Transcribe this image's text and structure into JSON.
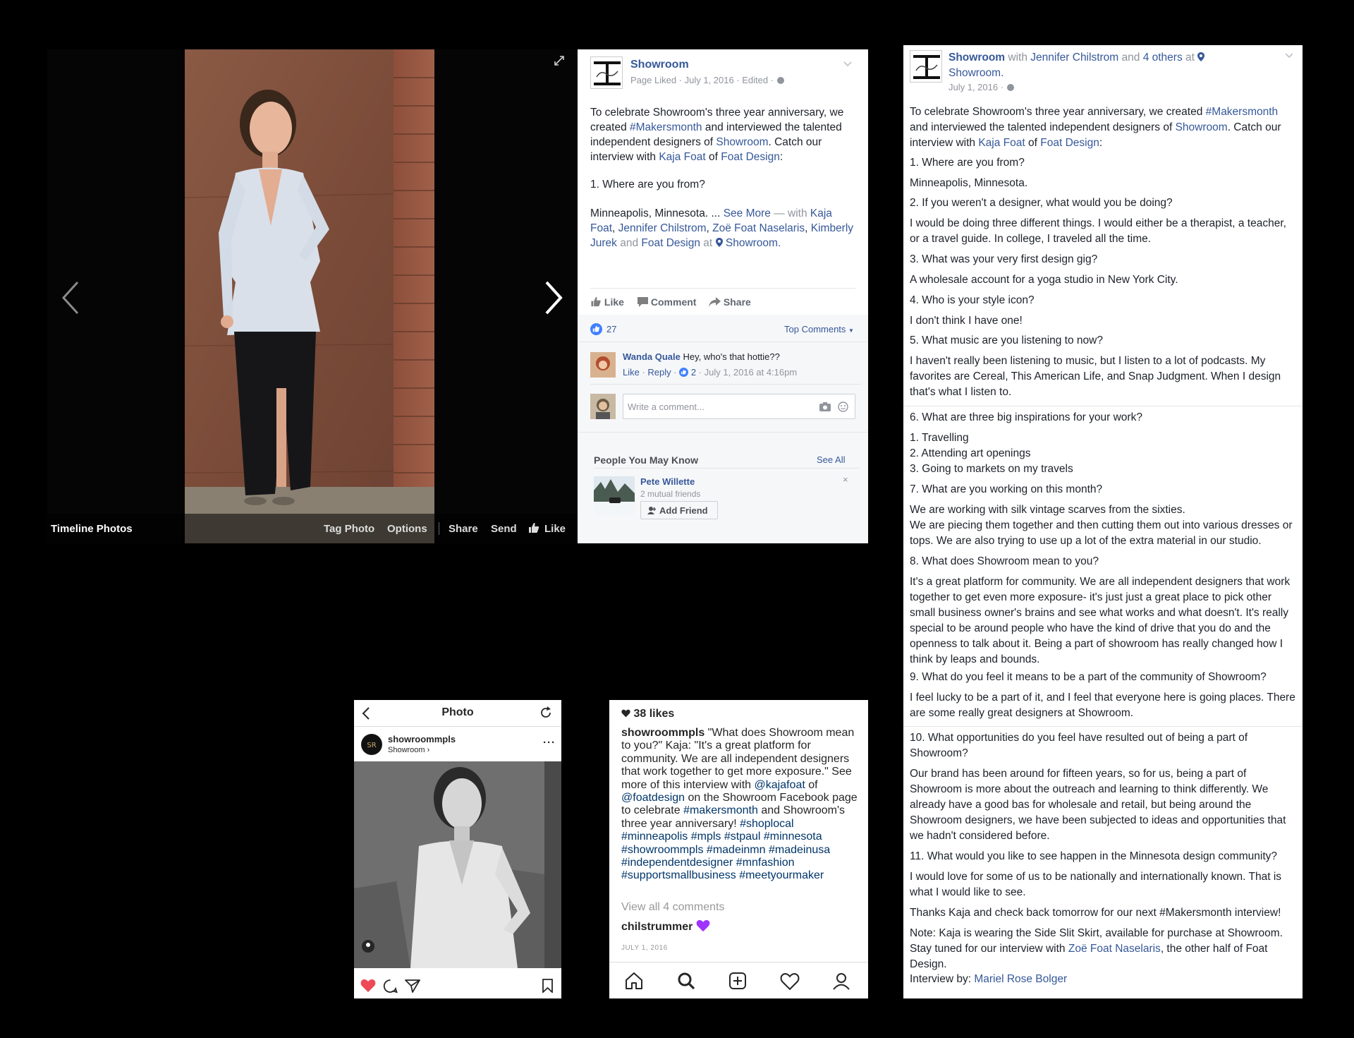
{
  "viewer": {
    "album": "Timeline Photos",
    "tag_photo": "Tag Photo",
    "options": "Options",
    "share": "Share",
    "send": "Send",
    "like": "Like"
  },
  "fbpost": {
    "page_name": "Showroom",
    "meta": "Page Liked · July 1, 2016 · Edited ·",
    "text_1": "To celebrate Showroom's three year anniversary, we created ",
    "hashtag": "#Makersmonth",
    "text_2": " and interviewed the talented independent designers of ",
    "showroom_link": "Showroom",
    "text_3": ". Catch our interview with ",
    "kaja_link": "Kaja Foat",
    "text_4": " of ",
    "foat_link": "Foat Design",
    "text_5": ":",
    "q1": "1. Where are you from?",
    "a1": "Minneapolis, Minnesota. ...",
    "see_more": "See More",
    "with": "— with",
    "tag_kaja": "Kaja Foat",
    "tag_jennifer": "Jennifer Chilstrom",
    "tag_zoe": "Zoë Foat Naselaris",
    "tag_kimberly": "Kimberly Jurek",
    "and": "and",
    "tag_foat": "Foat Design",
    "at": "at",
    "location": "Showroom.",
    "actions": {
      "like": "Like",
      "comment": "Comment",
      "share": "Share"
    },
    "like_count": "27",
    "top_comments": "Top Comments",
    "comment": {
      "author": "Wanda Quale",
      "text": "Hey, who's that hottie??",
      "like": "Like",
      "reply": "Reply",
      "reactions": "2",
      "time": "July 1, 2016 at 4:16pm"
    },
    "comment_placeholder": "Write a comment...",
    "pymk": {
      "title": "People You May Know",
      "see_all": "See All",
      "name": "Pete Willette",
      "mutual": "2 mutual friends",
      "add_friend": "Add Friend"
    }
  },
  "fblong": {
    "page_name": "Showroom",
    "with": "with",
    "tagged": "Jennifer Chilstrom",
    "and": "and",
    "others": "4 others",
    "at": "at",
    "location": "Showroom.",
    "date": "July 1, 2016 ·",
    "intro_1": "To celebrate Showroom's three year anniversary, we created ",
    "intro_hashtag": "#Makersmonth",
    "intro_2": " and interviewed the talented independent designers of ",
    "intro_showroom": "Showroom",
    "intro_3": ". Catch our interview with ",
    "intro_kaja": "Kaja Foat",
    "intro_4": " of ",
    "intro_foat": "Foat Design",
    "intro_5": ":",
    "q1": "1. Where are you from?",
    "a1": "Minneapolis, Minnesota.",
    "q2": "2. If you weren't a designer, what would you be doing?",
    "a2": "I would be doing three different things. I would either be a therapist, a teacher, or a travel guide. In college, I traveled all the time.",
    "q3": "3. What was your very first design gig?",
    "a3": "A wholesale account for a yoga studio in New York City.",
    "q4": "4. Who is your style icon?",
    "a4": "I don't think I have one!",
    "q5": "5. What music are you listening to now?",
    "a5": "I haven't really been listening to music, but I listen to a lot of podcasts. My favorites are Cereal, This American Life, and Snap Judgment. When I design that's what I listen to.",
    "q6": "6. What are three big inspirations for your work?",
    "a6_1": "1. Travelling",
    "a6_2": "2. Attending art openings",
    "a6_3": "3. Going to markets on my travels",
    "q7": "7. What are you working on this month?",
    "a7_1": "We are working with silk vintage scarves from the sixties.",
    "a7_2": "We are piecing them together and then cutting them out into various dresses or tops. We are also trying to use up a lot of the extra material in our studio.",
    "q8": "8. What does Showroom mean to you?",
    "a8": "It's a great platform for community. We are all independent designers that work together to get even more exposure- it's just just a great place to pick other small business owner's brains and see what works and what doesn't. It's really special to be around people who have the kind of drive that you do and the openness to talk about it. Being a part of showroom has really changed how I think by leaps and bounds.",
    "q9": "9. What do you feel it means to be a part of the community of Showroom?",
    "a9": "I feel lucky to be a part of it, and I feel that everyone here is going places. There are some really great designers at Showroom.",
    "q10": "10. What opportunities do you feel have resulted out of being a part of Showroom?",
    "a10": "Our brand has been around for fifteen years, so for us, being a part of Showroom is more about the outreach and learning to think differently. We already have a good bas for wholesale and retail, but being around the Showroom designers, we have been subjected to ideas and opportunities that we hadn't considered before.",
    "q11": "11. What would you like to see happen in the Minnesota design community?",
    "a11": "I would love for some of us to be nationally and internationally known. That is what I would like to see.",
    "thanks": "Thanks Kaja and check back tomorrow for our next #Makersmonth interview!",
    "note_1": "Note: Kaja is wearing the Side Slit Skirt, available for purchase at Showroom. Stay tuned for our interview with ",
    "note_zoe": "Zoë Foat Naselaris",
    "note_2": ", the other half of Foat Design.",
    "interview_by": "Interview by: ",
    "interviewer": "Mariel Rose Bolger"
  },
  "igphoto": {
    "title": "Photo",
    "username": "showroommpls",
    "location": "Showroom ›"
  },
  "igcaption": {
    "likes": "38 likes",
    "username": "showroommpls",
    "caption_1": " \"What does Showroom mean to you?\" Kaja: \"It's a great platform for community. We are all independent designers that work together to get more exposure.\" See more of this interview with ",
    "mention_1": "@kajafoat",
    "caption_2": " of ",
    "mention_2": "@foatdesign",
    "caption_3": " on the Showroom Facebook page to celebrate ",
    "tag_1": "#makersmonth",
    "caption_4": " and Showroom's three year anniversary! ",
    "tags": "#shoplocal #minneapolis #mpls #stpaul #minnesota #showroommpls #madeinmn #madeinusa #independentdesigner #mnfashion #supportsmallbusiness #meetyourmaker",
    "view_comments": "View all 4 comments",
    "commenter": "chilstrummer",
    "date": "JULY 1, 2016"
  },
  "colors": {
    "fb_link": "#365899",
    "ig_link": "#003569",
    "heart": "#ed4956"
  }
}
